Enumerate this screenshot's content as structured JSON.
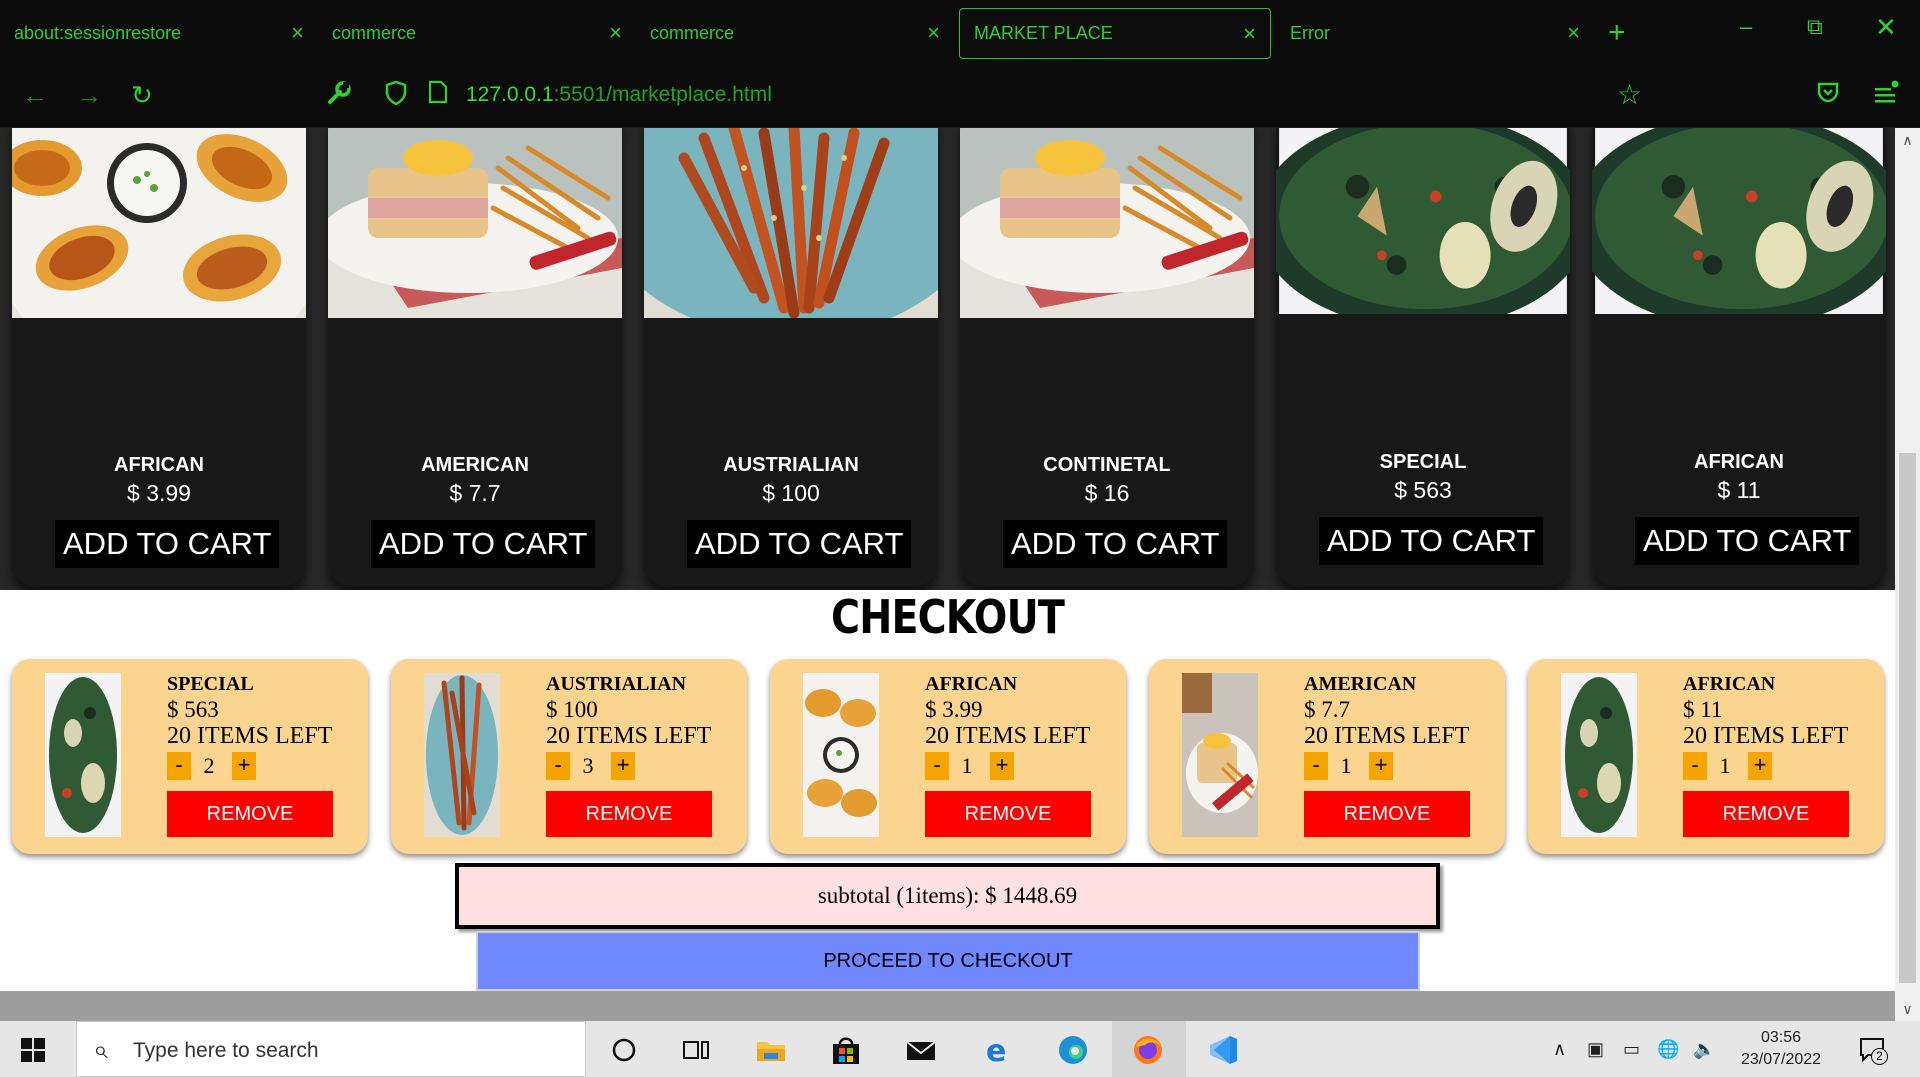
{
  "browser": {
    "tabs": [
      {
        "title": "about:sessionrestore"
      },
      {
        "title": "commerce"
      },
      {
        "title": "commerce"
      },
      {
        "title": "MARKET PLACE",
        "active": true
      },
      {
        "title": "Error"
      }
    ],
    "tab_close_glyph": "×",
    "url_host": "127.0.0.1",
    "url_rest": ":5501/marketplace.html",
    "icons": [
      "back-arrow-icon",
      "forward-arrow-icon",
      "reload-icon",
      "wrench-icon",
      "shield-icon",
      "page-icon",
      "bookmark-star-icon",
      "pocket-icon",
      "menu-icon"
    ]
  },
  "products": [
    {
      "name": "AFRICAN",
      "price": "$ 3.99",
      "button": "ADD TO CART",
      "image": "potato-skins"
    },
    {
      "name": "AMERICAN",
      "price": "$ 7.7",
      "button": "ADD TO CART",
      "image": "sandwich-fries"
    },
    {
      "name": "AUSTRIALIAN",
      "price": "$ 100",
      "button": "ADD TO CART",
      "image": "roasted-carrots"
    },
    {
      "name": "CONTINETAL",
      "price": "$ 16",
      "button": "ADD TO CART",
      "image": "sandwich-fries"
    },
    {
      "name": "SPECIAL",
      "price": "$ 563",
      "button": "ADD TO CART",
      "image": "green-stew"
    },
    {
      "name": "AFRICAN",
      "price": "$ 11",
      "button": "ADD TO CART",
      "image": "green-stew"
    }
  ],
  "checkout": {
    "title": "CHECKOUT",
    "items": [
      {
        "name": "SPECIAL",
        "price": "$ 563",
        "stock": "20 ITEMS LEFT",
        "qty": "2",
        "minus": "-",
        "plus": "+",
        "remove": "REMOVE",
        "image": "green-stew"
      },
      {
        "name": "AUSTRIALIAN",
        "price": "$ 100",
        "stock": "20 ITEMS LEFT",
        "qty": "3",
        "minus": "-",
        "plus": "+",
        "remove": "REMOVE",
        "image": "roasted-carrots"
      },
      {
        "name": "AFRICAN",
        "price": "$ 3.99",
        "stock": "20 ITEMS LEFT",
        "qty": "1",
        "minus": "-",
        "plus": "+",
        "remove": "REMOVE",
        "image": "potato-skins"
      },
      {
        "name": "AMERICAN",
        "price": "$ 7.7",
        "stock": "20 ITEMS LEFT",
        "qty": "1",
        "minus": "-",
        "plus": "+",
        "remove": "REMOVE",
        "image": "sandwich-fries"
      },
      {
        "name": "AFRICAN",
        "price": "$ 11",
        "stock": "20 ITEMS LEFT",
        "qty": "1",
        "minus": "-",
        "plus": "+",
        "remove": "REMOVE",
        "image": "green-stew"
      }
    ],
    "subtotal": "subtotal (1items): $ 1448.69",
    "proceed": "PROCEED TO CHECKOUT"
  },
  "taskbar": {
    "search_placeholder": "Type here to search",
    "time": "03:56",
    "date": "23/07/2022",
    "notification_count": "2",
    "apps": [
      "cortana-icon",
      "task-view-icon",
      "file-explorer-icon",
      "store-icon",
      "mail-icon",
      "edge-legacy-icon",
      "edge-icon",
      "firefox-icon",
      "vscode-icon"
    ]
  },
  "colors": {
    "browser_accent": "#2fd12f",
    "card_dark": "#181818",
    "checkout_card": "#fbd48f",
    "remove_red": "#ff0000",
    "qty_orange": "#f5a400",
    "proceed_blue": "#7088ff",
    "subtotal_pink": "#ffe0e0"
  }
}
